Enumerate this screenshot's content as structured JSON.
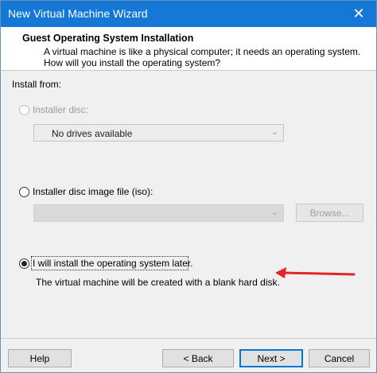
{
  "window": {
    "title": "New Virtual Machine Wizard",
    "close_glyph": "✕"
  },
  "header": {
    "title": "Guest Operating System Installation",
    "desc_line1": "A virtual machine is like a physical computer; it needs an operating system.",
    "desc_line2": "How will you install the operating system?"
  },
  "install_from": {
    "label": "Install from:",
    "options": [
      {
        "label": "Installer disc:",
        "selected": false,
        "enabled": false
      },
      {
        "label": "Installer disc image file (iso):",
        "selected": false,
        "enabled": true
      },
      {
        "label": "I will install the operating system later.",
        "selected": true,
        "enabled": true
      }
    ],
    "disc_dropdown_value": "No drives available",
    "iso_path_value": "",
    "browse_label": "Browse...",
    "later_note": "The virtual machine will be created with a blank hard disk."
  },
  "annotation": {
    "arrow_color": "#e2242b"
  },
  "footer": {
    "help": "Help",
    "back": "< Back",
    "next": "Next >",
    "cancel": "Cancel"
  }
}
